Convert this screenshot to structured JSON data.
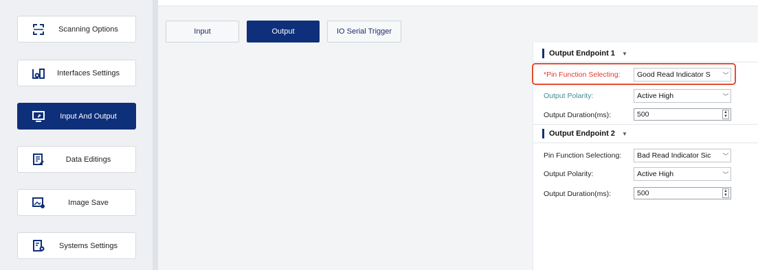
{
  "sidebar": {
    "items": [
      {
        "label": "Scanning Options",
        "icon": "scan-frame-icon",
        "active": false
      },
      {
        "label": "Interfaces Settings",
        "icon": "interfaces-icon",
        "active": false
      },
      {
        "label": "Input And Output",
        "icon": "monitor-io-icon",
        "active": true
      },
      {
        "label": "Data Editings",
        "icon": "document-edit-icon",
        "active": false
      },
      {
        "label": "Image Save",
        "icon": "image-save-icon",
        "active": false
      },
      {
        "label": "Systems Settings",
        "icon": "system-settings-icon",
        "active": false
      }
    ]
  },
  "tabs": [
    {
      "label": "Input",
      "active": false
    },
    {
      "label": "Output",
      "active": true
    },
    {
      "label": "IO Serial Trigger",
      "active": false
    }
  ],
  "endpoint1": {
    "title": "Output Endpoint 1",
    "pin_label": "*Pin Function Selecting:",
    "pin_value": "Good Read Indicator S",
    "polarity_label": "Output Polarity:",
    "polarity_value": "Active High",
    "duration_label": "Output Duration(ms):",
    "duration_value": "500"
  },
  "endpoint2": {
    "title": "Output Endpoint 2",
    "pin_label": "Pin Function Selectiong:",
    "pin_value": "Bad Read Indicator Sic",
    "polarity_label": "Output Polarity:",
    "polarity_value": "Active High",
    "duration_label": "Output Duration(ms):",
    "duration_value": "500"
  },
  "colors": {
    "accent": "#0e2f7a",
    "highlight": "#e44d2e",
    "required_label": "#e23a2f",
    "teal_label": "#3d8c94"
  }
}
